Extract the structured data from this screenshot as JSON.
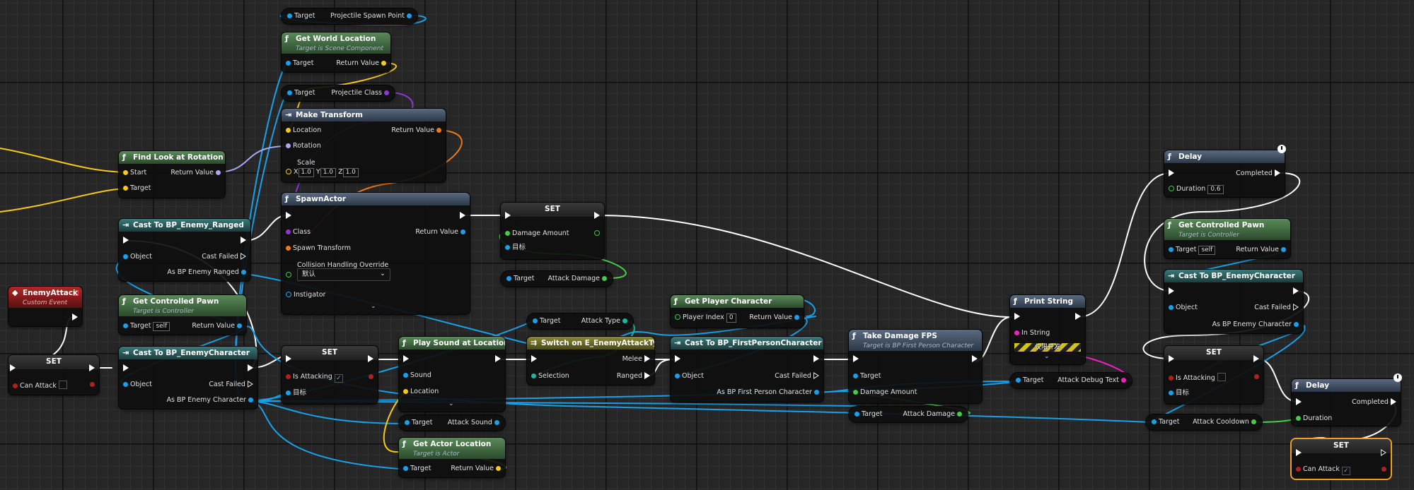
{
  "colors": {
    "exec": "#ffffff",
    "object": "#1aa0e8",
    "vector": "#f5c81a",
    "class": "#8a3ad0",
    "rotator": "#a8a8f0",
    "transform": "#f07a1a",
    "float": "#4ac84a",
    "enum": "#1ab8a0",
    "string": "#f020c0",
    "bool": "#b02020"
  },
  "top_get_spawn": {
    "target": "Target",
    "value": "Projectile Spawn Point"
  },
  "get_world_location": {
    "title": "Get World Location",
    "sub": "Target is Scene Component",
    "target": "Target",
    "ret": "Return Value"
  },
  "get_proj_class": {
    "target": "Target",
    "value": "Projectile Class"
  },
  "make_transform": {
    "title": "Make Transform",
    "location": "Location",
    "rotation": "Rotation",
    "scale": "Scale",
    "ret": "Return Value",
    "x": "1.0",
    "y": "1.0",
    "z": "1.0",
    "xl": "X",
    "yl": "Y",
    "zl": "Z"
  },
  "find_look": {
    "title": "Find Look at Rotation",
    "start": "Start",
    "target": "Target",
    "ret": "Return Value"
  },
  "spawn_actor": {
    "title": "SpawnActor",
    "class": "Class",
    "spawn_transform": "Spawn Transform",
    "collision": "Collision Handling Override",
    "collision_value": "默认",
    "instigator": "Instigator",
    "ret": "Return Value"
  },
  "set_damage": {
    "title": "SET",
    "damage": "Damage Amount",
    "target": "目标"
  },
  "get_attack_damage1": {
    "target": "Target",
    "value": "Attack Damage"
  },
  "cast_ranged": {
    "title": "Cast To BP_Enemy_Ranged",
    "object": "Object",
    "failed": "Cast Failed",
    "as": "As BP Enemy Ranged"
  },
  "enemy_attack": {
    "title": "EnemyAttack",
    "sub": "Custom Event"
  },
  "get_pawn1": {
    "title": "Get Controlled Pawn",
    "sub": "Target is Controller",
    "target": "Target",
    "self": "self",
    "ret": "Return Value"
  },
  "set_can_attack1": {
    "title": "SET",
    "label": "Can Attack"
  },
  "cast_enemy1": {
    "title": "Cast To BP_EnemyCharacter",
    "object": "Object",
    "failed": "Cast Failed",
    "as": "As BP Enemy Character"
  },
  "set_attacking1": {
    "title": "SET",
    "label": "Is Attacking",
    "target": "目标"
  },
  "play_sound": {
    "title": "Play Sound at Location",
    "sound": "Sound",
    "location": "Location"
  },
  "get_attack_sound": {
    "target": "Target",
    "value": "Attack Sound"
  },
  "get_actor_location": {
    "title": "Get Actor Location",
    "sub": "Target is Actor",
    "target": "Target",
    "ret": "Return Value"
  },
  "get_attack_type": {
    "target": "Target",
    "value": "Attack Type"
  },
  "switch_type": {
    "title": "Switch on E_EnemyAttackType",
    "selection": "Selection",
    "melee": "Melee",
    "ranged": "Ranged"
  },
  "get_player": {
    "title": "Get Player Character",
    "index": "Player Index",
    "index_value": "0",
    "ret": "Return Value"
  },
  "cast_fps": {
    "title": "Cast To BP_FirstPersonCharacter",
    "object": "Object",
    "failed": "Cast Failed",
    "as": "As BP First Person Character"
  },
  "take_damage": {
    "title": "Take Damage FPS",
    "sub": "Target is BP First Person Character",
    "target": "Target",
    "damage": "Damage Amount"
  },
  "get_attack_damage2": {
    "target": "Target",
    "value": "Attack Damage"
  },
  "print_string": {
    "title": "Print String",
    "in": "In String",
    "dev": "仅限开发"
  },
  "get_debug_text": {
    "target": "Target",
    "value": "Attack Debug Text"
  },
  "delay1": {
    "title": "Delay",
    "completed": "Completed",
    "duration": "Duration",
    "duration_value": "0.6"
  },
  "get_pawn2": {
    "title": "Get Controlled Pawn",
    "sub": "Target is Controller",
    "target": "Target",
    "self": "self",
    "ret": "Return Value"
  },
  "cast_enemy2": {
    "title": "Cast To BP_EnemyCharacter",
    "object": "Object",
    "failed": "Cast Failed",
    "as": "As BP Enemy Character"
  },
  "set_attacking2": {
    "title": "SET",
    "label": "Is Attacking",
    "target": "目标"
  },
  "get_cooldown": {
    "target": "Target",
    "value": "Attack Cooldown"
  },
  "delay2": {
    "title": "Delay",
    "completed": "Completed",
    "duration": "Duration"
  },
  "set_can_attack2": {
    "title": "SET",
    "label": "Can Attack",
    "check": "✓"
  },
  "glyphs": {
    "func": "ƒ",
    "cast": "⇥",
    "event": "◆",
    "check": "✓",
    "chev": "⌄",
    "switch": "⇉"
  }
}
